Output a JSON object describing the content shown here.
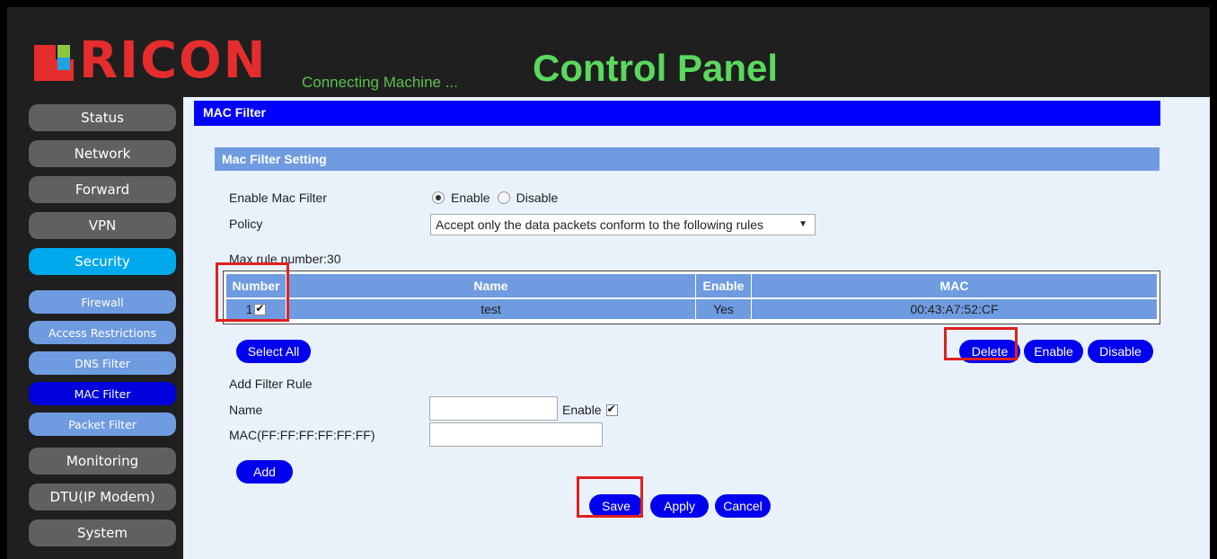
{
  "header": {
    "logo_text": "RICON",
    "tagline": "Connecting Machine ...",
    "title": "Control Panel"
  },
  "sidebar": {
    "items": [
      {
        "label": "Status"
      },
      {
        "label": "Network"
      },
      {
        "label": "Forward"
      },
      {
        "label": "VPN"
      },
      {
        "label": "Security"
      },
      {
        "label": "Monitoring"
      },
      {
        "label": "DTU(IP Modem)"
      },
      {
        "label": "System"
      }
    ],
    "sub_items": [
      {
        "label": "Firewall"
      },
      {
        "label": "Access Restrictions"
      },
      {
        "label": "DNS Filter"
      },
      {
        "label": "MAC Filter"
      },
      {
        "label": "Packet Filter"
      }
    ]
  },
  "page": {
    "title": "MAC Filter",
    "section_title": "Mac Filter Setting",
    "enable_label": "Enable Mac Filter",
    "radio_enable": "Enable",
    "radio_disable": "Disable",
    "policy_label": "Policy",
    "policy_value": "Accept only the data packets conform to the following rules",
    "max_rule": "Max rule number:30"
  },
  "table": {
    "headers": [
      "Number",
      "Name",
      "Enable",
      "MAC"
    ],
    "rows": [
      {
        "number": "1",
        "name": "test",
        "enable": "Yes",
        "mac": "00:43:A7:52:CF"
      }
    ]
  },
  "buttons": {
    "select_all": "Select All",
    "delete": "Delete",
    "enable": "Enable",
    "disable": "Disable",
    "add": "Add",
    "save": "Save",
    "apply": "Apply",
    "cancel": "Cancel"
  },
  "add_rule": {
    "heading": "Add Filter Rule",
    "name_label": "Name",
    "enable_label": "Enable",
    "mac_label": "MAC(FF:FF:FF:FF:FF:FF)",
    "name_value": "",
    "mac_value": ""
  },
  "colors": {
    "brand_red": "#e52d2d",
    "title_green": "#5bd85e",
    "nav_active": "#00a8ec",
    "title_bar": "#0000ff",
    "button": "#0000ee",
    "highlight": "#e02020"
  }
}
